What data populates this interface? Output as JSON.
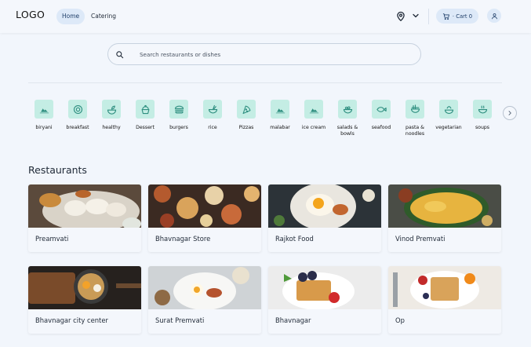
{
  "header": {
    "logo": "LOGO",
    "nav": [
      {
        "label": "Home",
        "active": true
      },
      {
        "label": "Catering",
        "active": false
      }
    ],
    "location_icon": "location-pin-icon",
    "dropdown_icon": "chevron-down-icon",
    "cart_label": "· Cart 0",
    "cart_icon": "cart-icon",
    "user_icon": "user-icon"
  },
  "search": {
    "placeholder": "Search restaurants or dishes",
    "icon": "search-icon"
  },
  "categories": [
    {
      "label": "biryani",
      "icon": "biryani-icon"
    },
    {
      "label": "breakfast",
      "icon": "breakfast-icon"
    },
    {
      "label": "healthy",
      "icon": "healthy-icon"
    },
    {
      "label": "Dessert",
      "icon": "dessert-icon"
    },
    {
      "label": "burgers",
      "icon": "burger-icon"
    },
    {
      "label": "rice",
      "icon": "rice-icon"
    },
    {
      "label": "Pizzas",
      "icon": "pizza-icon"
    },
    {
      "label": "malabar",
      "icon": "malabar-icon"
    },
    {
      "label": "ice cream",
      "icon": "ice-cream-icon"
    },
    {
      "label": "salads & bowls",
      "icon": "salad-bowl-icon"
    },
    {
      "label": "seafood",
      "icon": "fish-icon"
    },
    {
      "label": "pasta & noodles",
      "icon": "noodles-icon"
    },
    {
      "label": "vegetarian",
      "icon": "vegetarian-icon"
    },
    {
      "label": "soups",
      "icon": "soup-icon"
    }
  ],
  "restaurants_title": "Restaurants",
  "restaurants": [
    {
      "name": "Preamvati"
    },
    {
      "name": "Bhavnagar Store"
    },
    {
      "name": "Rajkot Food"
    },
    {
      "name": "Vinod Premvati"
    },
    {
      "name": "Bhavnagar city center"
    },
    {
      "name": "Surat Premvati"
    },
    {
      "name": "Bhavnagar"
    },
    {
      "name": "Op"
    }
  ],
  "colors": {
    "background": "#f2f6fc",
    "accent_pill": "#dde9f8",
    "category_tile": "#c4ede4",
    "category_icon": "#2f8f80"
  }
}
